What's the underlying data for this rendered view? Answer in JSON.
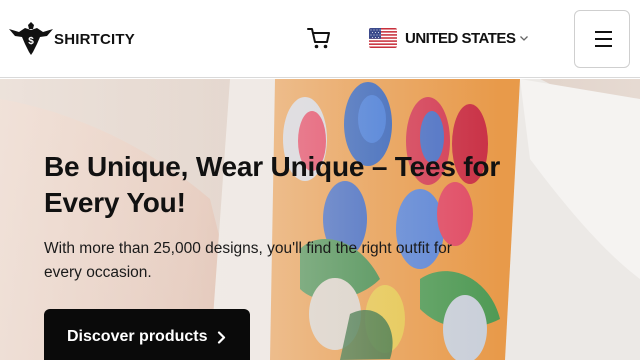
{
  "header": {
    "logo": {
      "name_bold": "SHIRTCITY",
      "icon": "eagle-dollar-logo-icon"
    },
    "cart": {
      "icon": "shopping-cart-icon"
    },
    "country": {
      "label": "UNITED STATES",
      "flag_icon": "us-flag-icon",
      "chevron_icon": "chevron-down-icon"
    },
    "menu": {
      "icon": "hamburger-menu-icon"
    }
  },
  "hero": {
    "headline": "Be Unique, Wear Unique – Tees for Every You!",
    "subline": "With more than 25,000 designs, you'll find the right outfit for every occasion.",
    "cta_label": "Discover products",
    "cta_icon": "chevron-right-icon",
    "background": "person-wearing-parrot-print-tshirt-photo"
  },
  "colors": {
    "text": "#111111",
    "cta_bg": "#0a0a0a",
    "cta_text": "#ffffff",
    "shirt_orange": "#e89a4a"
  }
}
